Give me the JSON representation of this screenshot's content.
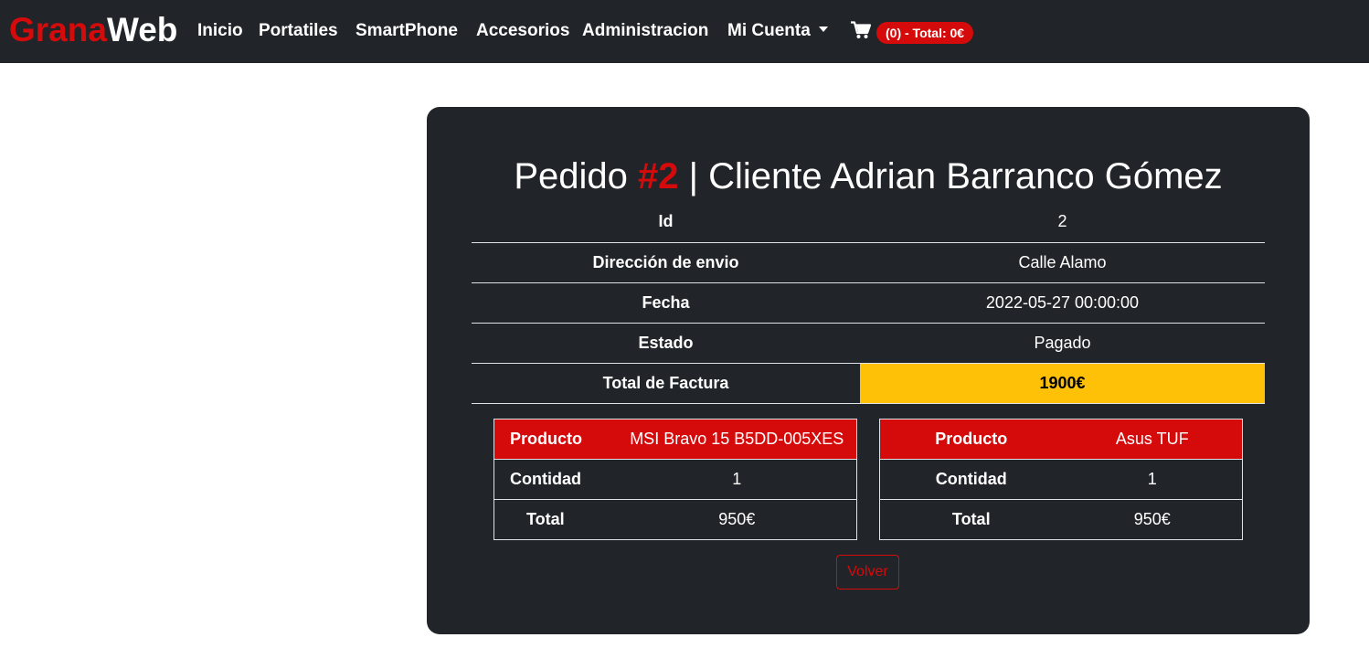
{
  "navbar": {
    "brand_part1": "Grana",
    "brand_part2": "Web",
    "items": [
      "Inicio",
      "Portatiles",
      "SmartPhone",
      "Accesorios",
      "Administracion",
      "Mi Cuenta"
    ],
    "cart_icon": "shopping-cart-icon",
    "cart_badge": "(0) - Total: 0€"
  },
  "order": {
    "title_prefix": "Pedido ",
    "title_number": "#2",
    "title_suffix": " | Cliente Adrian Barranco Gómez",
    "rows": [
      {
        "label": "Id",
        "value": "2"
      },
      {
        "label": "Dirección de envio",
        "value": "Calle Alamo"
      },
      {
        "label": "Fecha",
        "value": "2022-05-27 00:00:00"
      },
      {
        "label": "Estado",
        "value": "Pagado"
      },
      {
        "label": "Total de Factura",
        "value": "1900€"
      }
    ]
  },
  "products": [
    {
      "product_label": "Producto",
      "product": "MSI Bravo 15 B5DD-005XES",
      "qty_label": "Contidad",
      "qty": "1",
      "total_label": "Total",
      "total": "950€"
    },
    {
      "product_label": "Producto",
      "product": "Asus TUF",
      "qty_label": "Contidad",
      "qty": "1",
      "total_label": "Total",
      "total": "950€"
    }
  ],
  "back_button": "Volver",
  "colors": {
    "brand_red": "#d50b0b",
    "dark": "#212529",
    "highlight": "#ffc107"
  }
}
